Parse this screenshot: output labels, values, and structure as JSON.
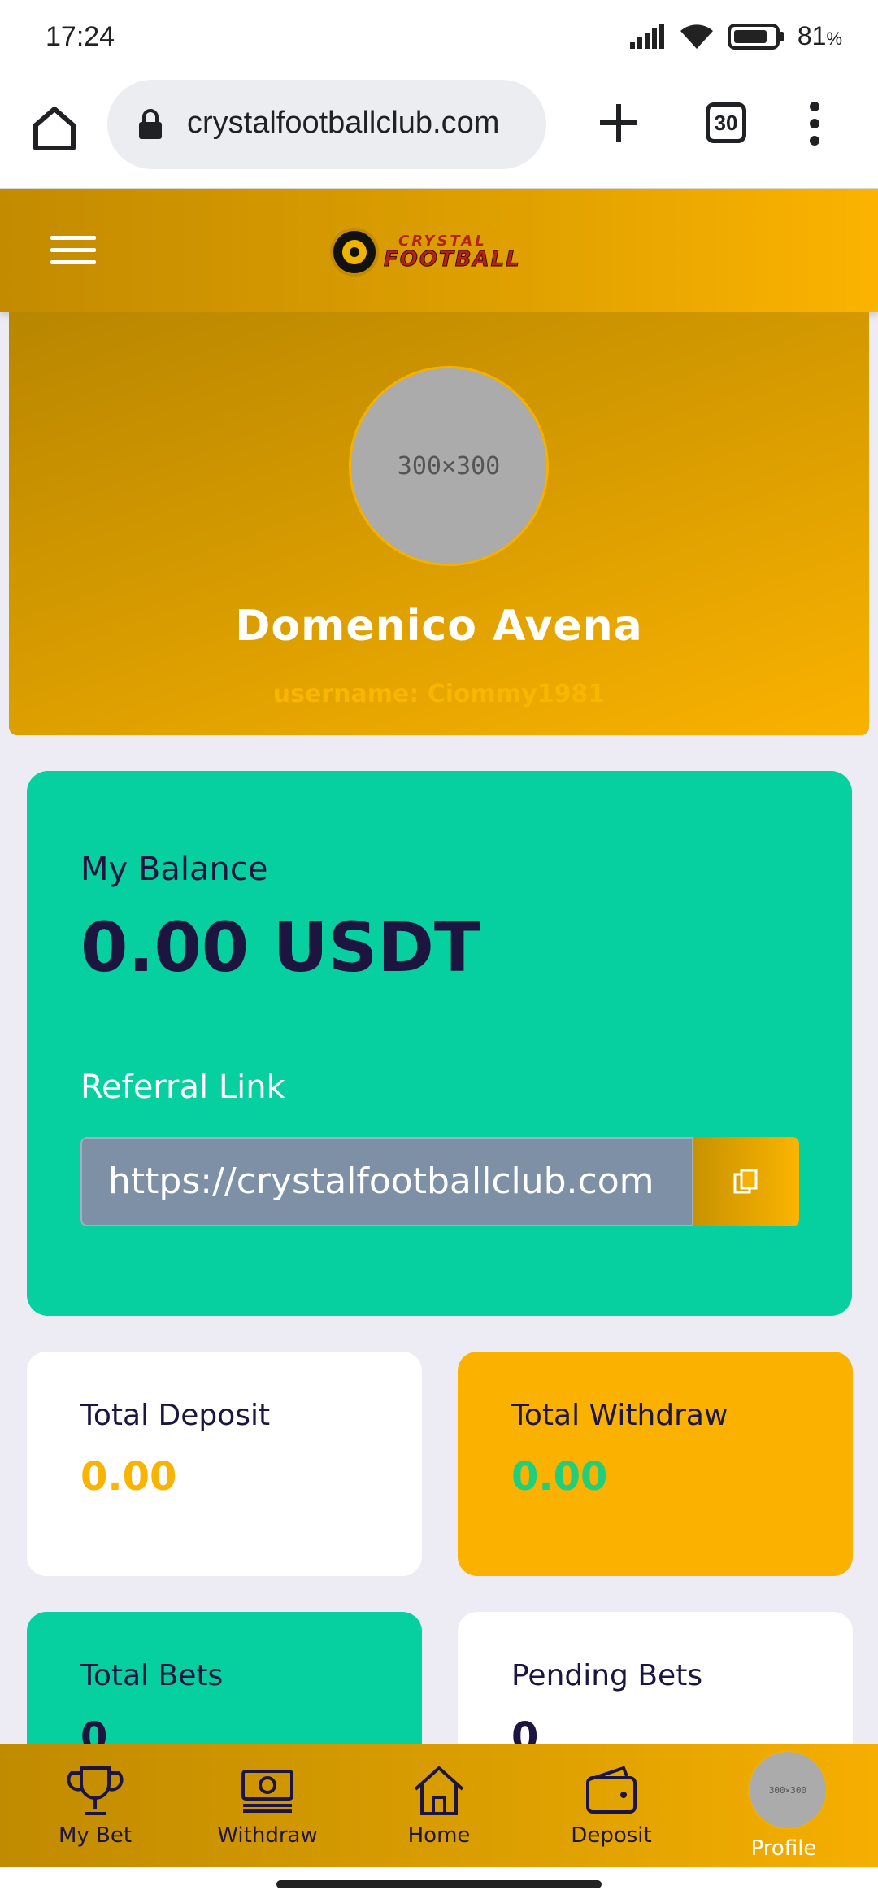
{
  "status_bar": {
    "time": "17:24",
    "battery": "81",
    "battery_unit": "%"
  },
  "browser": {
    "url": "crystalfootballclub.com",
    "tab_count": "30"
  },
  "site_header": {
    "logo_line1": "CRYSTAL",
    "logo_line2": "FOOTBALL"
  },
  "profile": {
    "avatar_placeholder": "300×300",
    "name": "Domenico Avena",
    "username": "username: Ciommy1981"
  },
  "balance": {
    "label": "My Balance",
    "value": "0.00 USDT",
    "referral_label": "Referral Link",
    "referral_link": "https://crystalfootballclub.com"
  },
  "stats": [
    {
      "label": "Total Deposit",
      "value": "0.00"
    },
    {
      "label": "Total Withdraw",
      "value": "0.00"
    },
    {
      "label": "Total Bets",
      "value": "0"
    },
    {
      "label": "Pending Bets",
      "value": "0"
    }
  ],
  "bottom_nav": [
    {
      "label": "My Bet",
      "icon": "trophy-icon"
    },
    {
      "label": "Withdraw",
      "icon": "cash-icon"
    },
    {
      "label": "Home",
      "icon": "home-icon"
    },
    {
      "label": "Deposit",
      "icon": "wallet-icon"
    },
    {
      "label": "Profile",
      "icon": "avatar"
    }
  ],
  "colors": {
    "brand_gold": "#e0a100",
    "balance_green": "#06cfa0",
    "navy_text": "#1c1540",
    "deposit_value": "#f8b400",
    "withdraw_value": "#1fcf7c"
  }
}
